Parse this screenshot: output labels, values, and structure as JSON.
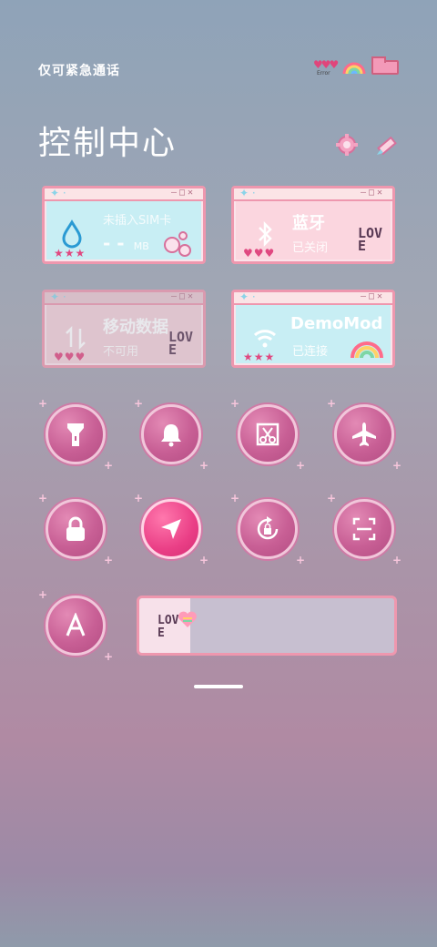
{
  "status_bar": {
    "carrier_text": "仅可紧急通话",
    "error_label": "Error"
  },
  "header": {
    "title": "控制中心"
  },
  "cards": [
    {
      "id": "data-usage",
      "title": "未插入SIM卡",
      "value": "- -",
      "unit": "MB",
      "stars": "★★★",
      "icon": "water-drop-icon"
    },
    {
      "id": "bluetooth",
      "title": "蓝牙",
      "status": "已关闭",
      "stars": "♥♥♥",
      "icon": "bluetooth-icon",
      "deco": "LOVE"
    },
    {
      "id": "mobile-data",
      "title": "移动数据",
      "status": "不可用",
      "stars": "♥♥♥",
      "icon": "mobile-data-icon",
      "deco": "LOVE"
    },
    {
      "id": "wifi",
      "title": "DemoMod",
      "status": "已连接",
      "stars": "★★★",
      "icon": "wifi-icon"
    }
  ],
  "toggles": [
    {
      "id": "flashlight",
      "icon": "flashlight-icon",
      "active": false
    },
    {
      "id": "ringer",
      "icon": "bell-icon",
      "active": false
    },
    {
      "id": "screenshot",
      "icon": "scissors-icon",
      "active": false
    },
    {
      "id": "airplane",
      "icon": "airplane-icon",
      "active": false
    },
    {
      "id": "lock",
      "icon": "lock-icon",
      "active": false
    },
    {
      "id": "location",
      "icon": "location-arrow-icon",
      "active": true
    },
    {
      "id": "rotation-lock",
      "icon": "rotation-lock-icon",
      "active": false
    },
    {
      "id": "scanner",
      "icon": "scan-icon",
      "active": false
    },
    {
      "id": "auto-brightness",
      "icon": "letter-a-icon",
      "active": false
    }
  ],
  "brightness": {
    "level": 0.2,
    "deco": "LOVE"
  },
  "colors": {
    "card_border": "#ee97ae",
    "card_blue": "#c8eef4",
    "card_pink": "#fbd6df",
    "toggle_active": "#ea3f86",
    "toggle": "#c85f95"
  }
}
